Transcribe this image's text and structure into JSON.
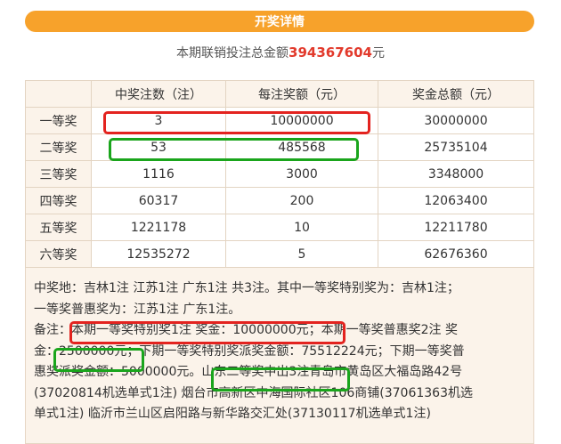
{
  "header": {
    "title": "开奖详情"
  },
  "total": {
    "prefix": "本期联销投注总金额",
    "amount": "394367604",
    "suffix": "元"
  },
  "table": {
    "columns": [
      "",
      "中奖注数（注）",
      "每注奖额（元）",
      "奖金总额（元）"
    ],
    "rows": [
      {
        "level": "一等奖",
        "count": "3",
        "per": "10000000",
        "total": "30000000"
      },
      {
        "level": "二等奖",
        "count": "53",
        "per": "485568",
        "total": "25735104"
      },
      {
        "level": "三等奖",
        "count": "1116",
        "per": "3000",
        "total": "3348000"
      },
      {
        "level": "四等奖",
        "count": "60317",
        "per": "200",
        "total": "12063400"
      },
      {
        "level": "五等奖",
        "count": "1221178",
        "per": "10",
        "total": "12211780"
      },
      {
        "level": "六等奖",
        "count": "12535272",
        "per": "5",
        "total": "62676360"
      }
    ]
  },
  "notes": {
    "line1": "中奖地：吉林1注 江苏1注 广东1注 共3注。其中一等奖特别奖为：吉林1注；",
    "line2": "一等奖普惠奖为：江苏1注 广东1注。",
    "line3": "备注：本期一等奖特别奖1注 奖金：10000000元；本期一等奖普惠奖2注 奖",
    "line4": "金：2500000元；下期一等奖特别奖派奖金额：75512224元；下期一等奖普",
    "line5": "惠奖派奖金额：5000000元。山东二等奖中出3注青岛市黄岛区大福岛路42号",
    "line6": "(37020814机选单式1注) 烟台市高新区中海国际社区106商铺(37061363机选",
    "line7": "单式1注) 临沂市兰山区启阳路与新华路交汇处(37130117机选单式1注)"
  },
  "colors": {
    "accent": "#f7a22b",
    "amount": "#e23a2c",
    "highlight_red": "#e3231f",
    "highlight_green": "#1aa51c"
  }
}
